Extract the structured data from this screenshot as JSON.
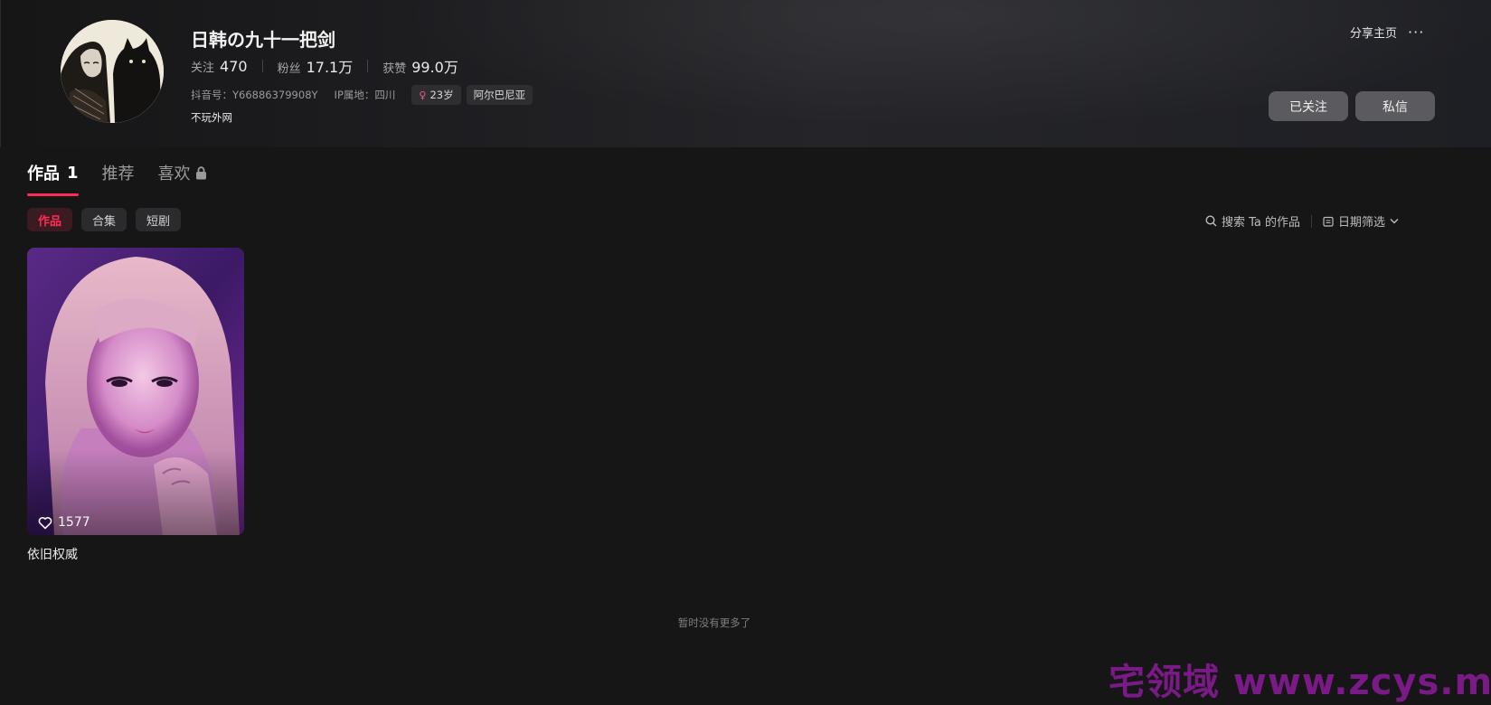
{
  "profile": {
    "name": "日韩の九十一把剑",
    "stats": {
      "following_label": "关注",
      "following": "470",
      "followers_label": "粉丝",
      "followers": "17.1万",
      "likes_label": "获赞",
      "likes": "99.0万"
    },
    "douyin_id": "抖音号：Y66886379908Y",
    "ip_location": "IP属地：四川",
    "age_tag": "23岁",
    "region_tag": "阿尔巴尼亚",
    "bio": "不玩外网"
  },
  "actions": {
    "share": "分享主页",
    "followed": "已关注",
    "message": "私信"
  },
  "tabs": [
    {
      "label": "作品",
      "count": "1"
    },
    {
      "label": "推荐"
    },
    {
      "label": "喜欢"
    }
  ],
  "chips": [
    "作品",
    "合集",
    "短剧"
  ],
  "tools": {
    "search": "搜索 Ta 的作品",
    "date_filter": "日期筛选"
  },
  "videos": [
    {
      "likes": "1577",
      "title": "依旧权威"
    }
  ],
  "footer": {
    "no_more": "暂时没有更多了"
  },
  "watermark": "宅领域 www.zcys.me",
  "colors": {
    "accent": "#fe2c55",
    "background": "#161616",
    "button": "#5a5a5f",
    "watermark": "#7a1a86"
  },
  "icons": [
    "more-icon",
    "lock-icon",
    "search-icon",
    "calendar-icon",
    "chevron-down-icon",
    "heart-icon",
    "female-icon"
  ]
}
